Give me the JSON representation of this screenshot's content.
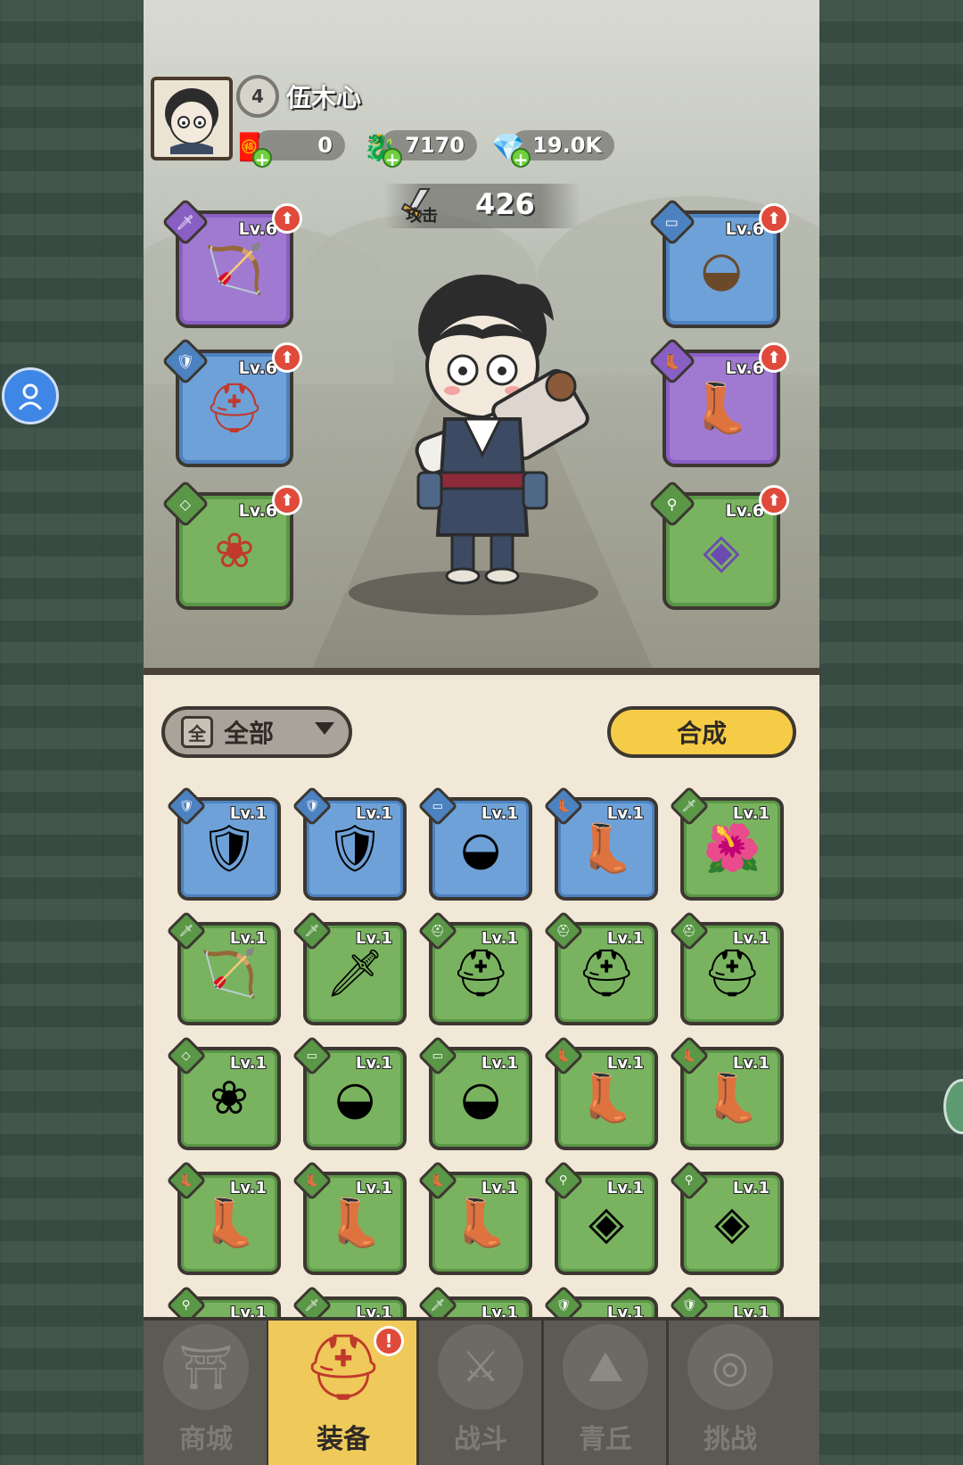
{
  "player": {
    "level": "4",
    "name": "伍木心"
  },
  "resources": [
    {
      "icon": "scroll-ticket-icon",
      "value": "0"
    },
    {
      "icon": "jade-dragon-icon",
      "value": "7170"
    },
    {
      "icon": "crystal-icon",
      "value": "19.0K"
    }
  ],
  "attack": {
    "label": "攻击",
    "value": "426"
  },
  "equipped": {
    "left": [
      {
        "slot": "weapon",
        "item": "bow",
        "level": "Lv.6",
        "rarity": "purple",
        "glyph": "🏹"
      },
      {
        "slot": "helmet",
        "item": "crimson-helmet",
        "level": "Lv.6",
        "rarity": "blue",
        "glyph": "⛑"
      },
      {
        "slot": "ring",
        "item": "crimson-ring",
        "level": "Lv.6",
        "rarity": "green",
        "glyph": "❀"
      }
    ],
    "right": [
      {
        "slot": "belt",
        "item": "golden-belt",
        "level": "Lv.6",
        "rarity": "blue",
        "glyph": "◒"
      },
      {
        "slot": "boots",
        "item": "violet-boots",
        "level": "Lv.6",
        "rarity": "purple",
        "glyph": "👢"
      },
      {
        "slot": "amulet",
        "item": "violet-amulet",
        "level": "Lv.6",
        "rarity": "green",
        "glyph": "◈"
      }
    ]
  },
  "filter": {
    "icon_label": "全",
    "label": "全部"
  },
  "synthesize_label": "合成",
  "inventory": [
    {
      "type": "armor",
      "rarity": "blue",
      "level": "Lv.1",
      "glyph": "🛡"
    },
    {
      "type": "armor",
      "rarity": "blue",
      "level": "Lv.1",
      "glyph": "🛡"
    },
    {
      "type": "belt",
      "rarity": "blue",
      "level": "Lv.1",
      "glyph": "◒"
    },
    {
      "type": "boots",
      "rarity": "blue",
      "level": "Lv.1",
      "glyph": "👢"
    },
    {
      "type": "weapon",
      "rarity": "green",
      "level": "Lv.1",
      "glyph": "🌺"
    },
    {
      "type": "weapon",
      "rarity": "green",
      "level": "Lv.1",
      "glyph": "🏹"
    },
    {
      "type": "weapon",
      "rarity": "green",
      "level": "Lv.1",
      "glyph": "🗡"
    },
    {
      "type": "helmet",
      "rarity": "green",
      "level": "Lv.1",
      "glyph": "⛑"
    },
    {
      "type": "helmet",
      "rarity": "green",
      "level": "Lv.1",
      "glyph": "⛑"
    },
    {
      "type": "helmet",
      "rarity": "green",
      "level": "Lv.1",
      "glyph": "⛑"
    },
    {
      "type": "ring",
      "rarity": "green",
      "level": "Lv.1",
      "glyph": "❀"
    },
    {
      "type": "belt",
      "rarity": "green",
      "level": "Lv.1",
      "glyph": "◒"
    },
    {
      "type": "belt",
      "rarity": "green",
      "level": "Lv.1",
      "glyph": "◒"
    },
    {
      "type": "boots",
      "rarity": "green",
      "level": "Lv.1",
      "glyph": "👢"
    },
    {
      "type": "boots",
      "rarity": "green",
      "level": "Lv.1",
      "glyph": "👢"
    },
    {
      "type": "boots",
      "rarity": "green",
      "level": "Lv.1",
      "glyph": "👢"
    },
    {
      "type": "boots",
      "rarity": "green",
      "level": "Lv.1",
      "glyph": "👢"
    },
    {
      "type": "boots",
      "rarity": "green",
      "level": "Lv.1",
      "glyph": "👢"
    },
    {
      "type": "amulet",
      "rarity": "green",
      "level": "Lv.1",
      "glyph": "◈"
    },
    {
      "type": "amulet",
      "rarity": "green",
      "level": "Lv.1",
      "glyph": "◈"
    },
    {
      "type": "amulet",
      "rarity": "green",
      "level": "Lv.1",
      "glyph": "◈"
    },
    {
      "type": "weapon",
      "rarity": "green",
      "level": "Lv.1",
      "glyph": "🗡"
    },
    {
      "type": "weapon",
      "rarity": "green",
      "level": "Lv.1",
      "glyph": "🗡"
    },
    {
      "type": "armor",
      "rarity": "green",
      "level": "Lv.1",
      "glyph": "🛡"
    },
    {
      "type": "armor",
      "rarity": "green",
      "level": "Lv.1",
      "glyph": "🛡"
    }
  ],
  "nav": [
    {
      "label": "商城",
      "icon": "pavilion-icon",
      "glyph": "⛩",
      "active": false
    },
    {
      "label": "装备",
      "icon": "helmet-icon",
      "glyph": "⛑",
      "active": true,
      "badge": "!"
    },
    {
      "label": "战斗",
      "icon": "crossed-swords-icon",
      "glyph": "⚔",
      "active": false
    },
    {
      "label": "青丘",
      "icon": "mountain-icon",
      "glyph": "⛰",
      "active": false
    },
    {
      "label": "挑战",
      "icon": "vortex-icon",
      "glyph": "◎",
      "active": false
    }
  ],
  "colors": {
    "purple": "#a07ad1",
    "blue": "#6ea1d7",
    "green": "#79b35f",
    "accent_yellow": "#f6cc46",
    "upgrade_red": "#e04a3a"
  }
}
